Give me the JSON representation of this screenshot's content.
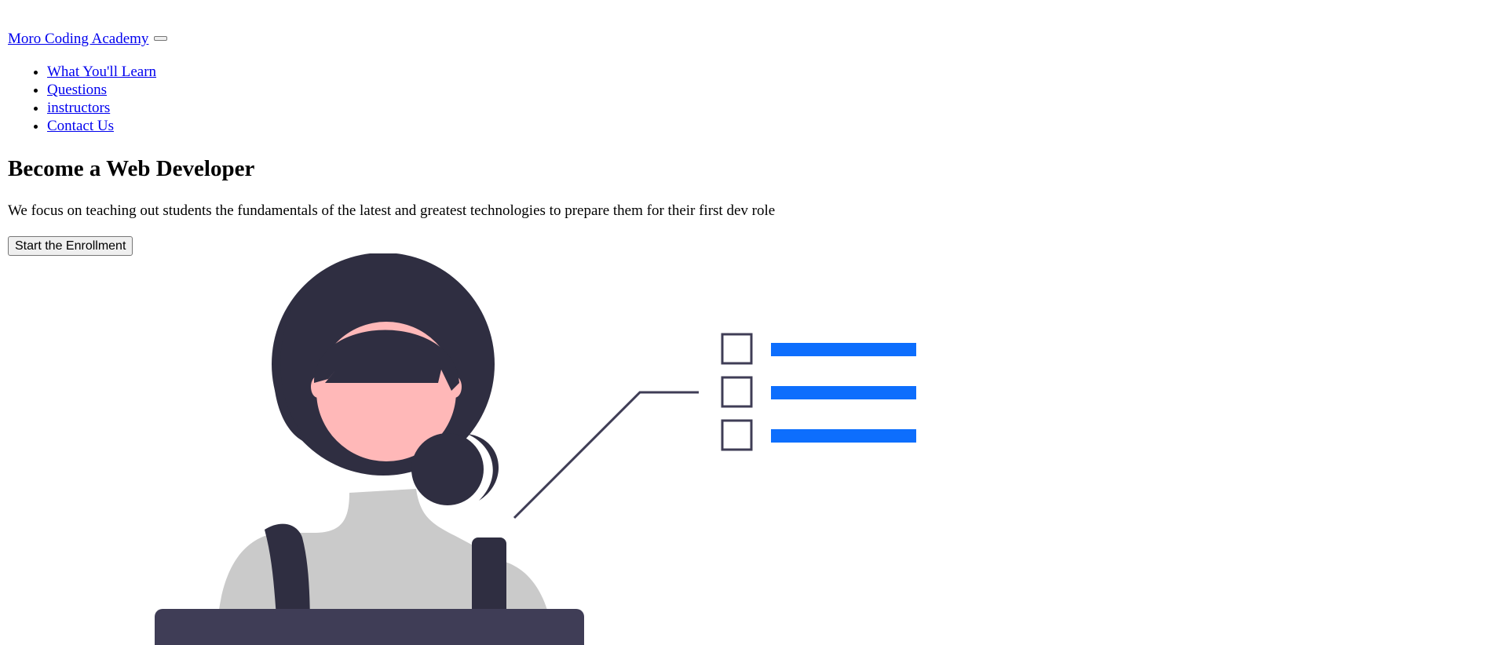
{
  "navbar": {
    "brand": "Moro Coding Academy",
    "toggler_label": "",
    "items": [
      {
        "label": "What You'll Learn"
      },
      {
        "label": "Questions"
      },
      {
        "label": "instructors"
      },
      {
        "label": "Contact Us"
      }
    ]
  },
  "hero": {
    "title": "Become a Web Developer",
    "description": "We focus on teaching out students the fundamentals of the latest and greatest technologies to prepare them for their first dev role",
    "cta_label": "Start the Enrollment"
  },
  "illustration": {
    "name": "student-with-laptop-and-checklist",
    "colors": {
      "hair": "#2f2e41",
      "skin": "#ffb8b8",
      "shirt": "#cacaca",
      "laptop": "#3f3d56",
      "checklist_box": "#3f3d56",
      "checklist_bar": "#0d6efd"
    }
  },
  "colors": {
    "link": "#0000ee",
    "text": "#000000",
    "background": "#ffffff"
  }
}
